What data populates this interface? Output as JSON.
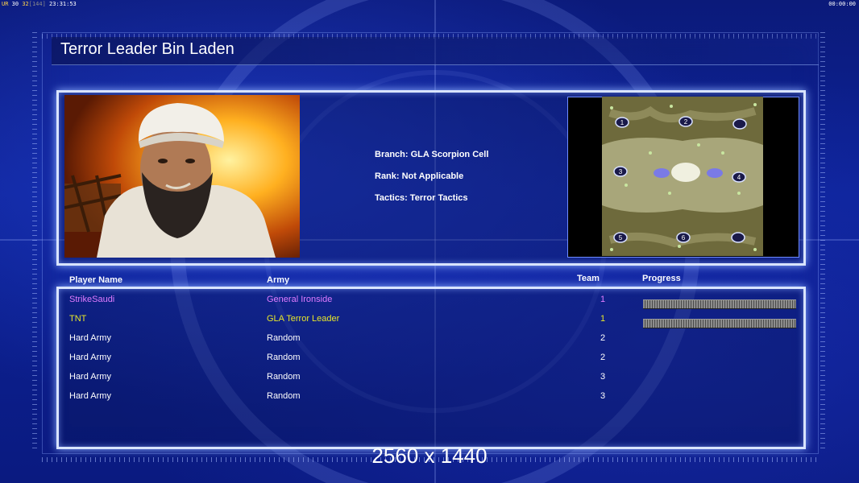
{
  "hud": {
    "left_prefix": "UR",
    "fps": "30",
    "fps_target": "32",
    "bracket_value": "[144]",
    "clock": "23:31:53",
    "right_clock": "00:00:00"
  },
  "header": {
    "title": "Terror Leader Bin Laden"
  },
  "general": {
    "branch": "Branch: GLA Scorpion Cell",
    "rank": "Rank: Not Applicable",
    "tactics": "Tactics: Terror Tactics"
  },
  "minimap": {
    "start_positions": [
      "1",
      "2",
      "3",
      "4",
      "5",
      "6"
    ]
  },
  "roster": {
    "headers": {
      "player": "Player Name",
      "army": "Army",
      "team": "Team",
      "progress": "Progress"
    },
    "players": [
      {
        "name": "StrikeSaudi",
        "army": "General Ironside",
        "team": "1",
        "color": "#e07bff",
        "progress": 1.0
      },
      {
        "name": "TNT",
        "army": "GLA Terror Leader",
        "team": "1",
        "color": "#e6e62a",
        "progress": 1.0
      },
      {
        "name": "Hard Army",
        "army": "Random",
        "team": "2",
        "color": "#ffffff"
      },
      {
        "name": "Hard Army",
        "army": "Random",
        "team": "2",
        "color": "#ffffff"
      },
      {
        "name": "Hard Army",
        "army": "Random",
        "team": "3",
        "color": "#ffffff"
      },
      {
        "name": "Hard Army",
        "army": "Random",
        "team": "3",
        "color": "#ffffff"
      }
    ]
  },
  "footer": {
    "resolution": "2560 x 1440"
  },
  "colors": {
    "background": "#0a1a8a",
    "panel_border": "#d9e4ff",
    "player1": "#e07bff",
    "player2": "#e6e62a"
  }
}
